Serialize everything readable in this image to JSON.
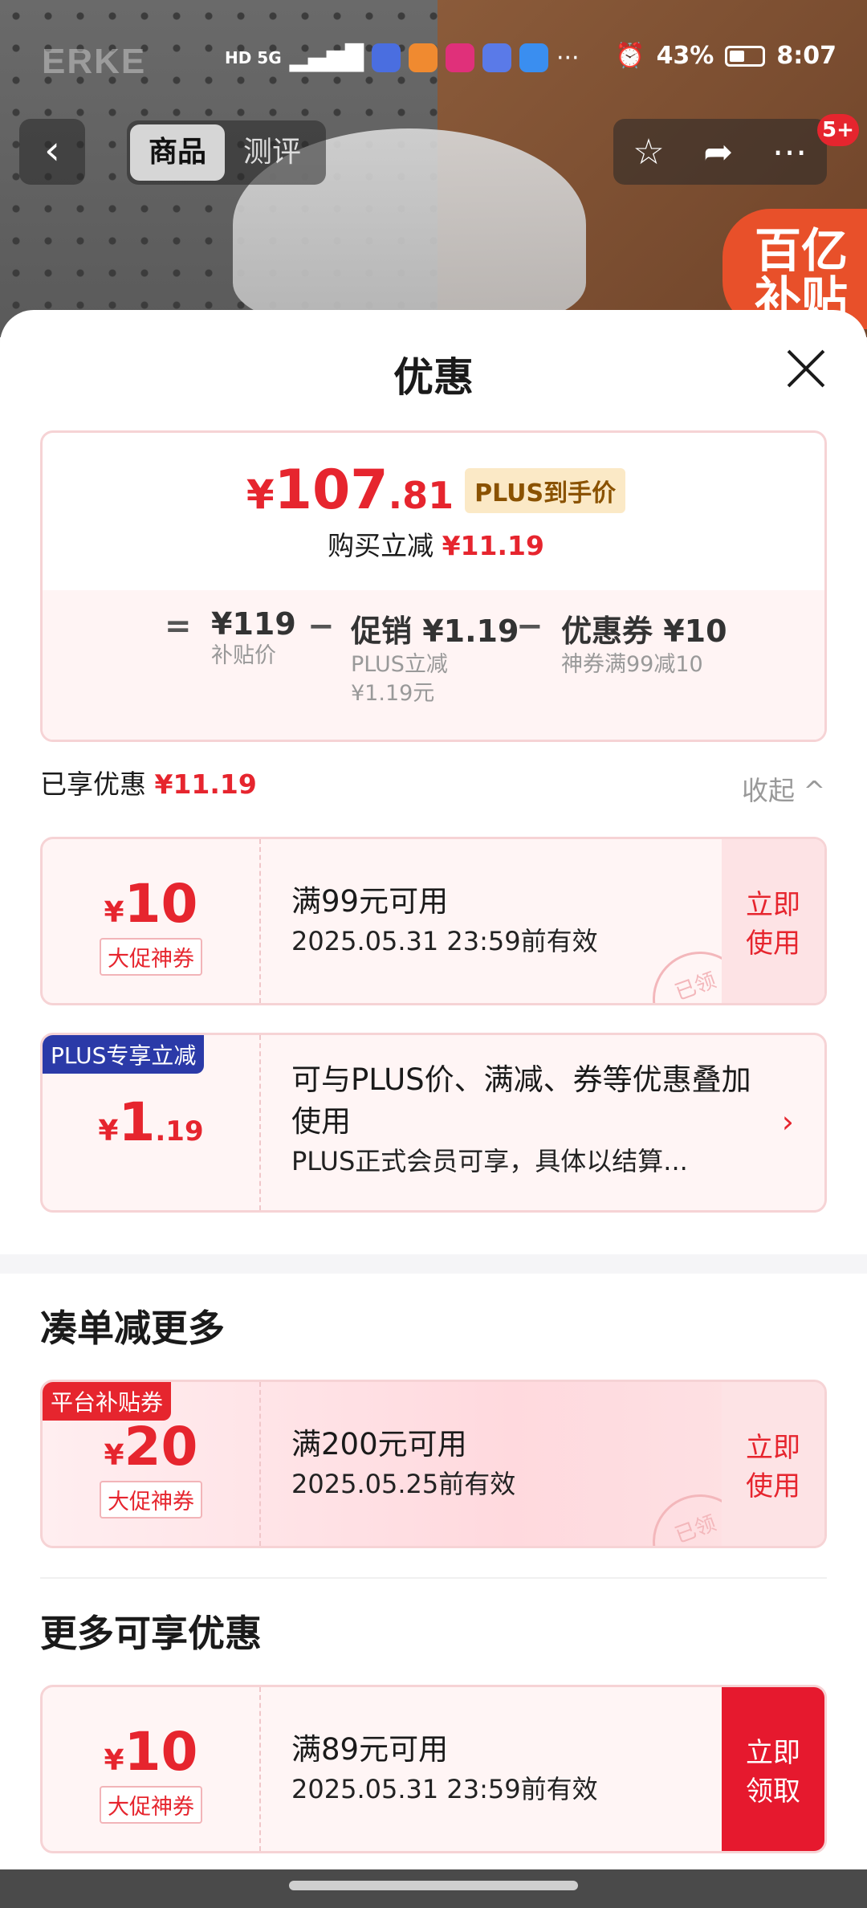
{
  "status_bar": {
    "battery": "43%",
    "time": "8:07",
    "signal_chip": "HD 5G"
  },
  "background": {
    "brand": "ERKE",
    "ad_badge": "百亿补贴"
  },
  "nav": {
    "back": "‹",
    "tabs": [
      "商品",
      "测评"
    ],
    "active_tab": 0,
    "cart_badge": "5+"
  },
  "sheet": {
    "title": "优惠",
    "price": {
      "yen": "¥",
      "integer": "107",
      "decimal": ".81",
      "tag": "PLUS到手价",
      "buy_label": "购买立减",
      "buy_amount": "¥11.19"
    },
    "breakdown": {
      "equals": "=",
      "base_value": "¥119",
      "base_label": "补贴价",
      "minus1": "−",
      "promo_value": "促销 ¥1.19",
      "promo_label1": "PLUS立减",
      "promo_label2": "¥1.19元",
      "minus2": "−",
      "coupon_value": "优惠券 ¥10",
      "coupon_label": "神券满99减10"
    },
    "enjoyed": {
      "label": "已享优惠",
      "amount": "¥11.19",
      "collapse": "收起 ^"
    },
    "coupons_enjoyed": [
      {
        "yen": "¥",
        "amount": "10",
        "decimal": "",
        "label": "大促神券",
        "title": "满99元可用",
        "sub": "2025.05.31 23:59前有效",
        "action": "立即\n使用",
        "stamp": "已领"
      },
      {
        "corner": "PLUS专享立减",
        "yen": "¥",
        "amount": "1",
        "decimal": ".19",
        "title": "可与PLUS价、满减、券等优惠叠加使用",
        "sub": "PLUS正式会员可享，具体以结算...",
        "chevron": "›"
      }
    ],
    "section_more": "凑单减更多",
    "coupon_platform": {
      "corner": "平台补贴券",
      "yen": "¥",
      "amount": "20",
      "label": "大促神券",
      "title": "满200元可用",
      "sub": "2025.05.25前有效",
      "action": "立即\n使用",
      "stamp": "已领"
    },
    "section_extra": "更多可享优惠",
    "coupon_claim": {
      "yen": "¥",
      "amount": "10",
      "label": "大促神券",
      "title": "满89元可用",
      "sub": "2025.05.31 23:59前有效",
      "action": "立即\n领取"
    }
  },
  "colors": {
    "accent_red": "#e6252e",
    "plus_blue": "#2b3aa8",
    "platform_red": "#e6252e"
  }
}
